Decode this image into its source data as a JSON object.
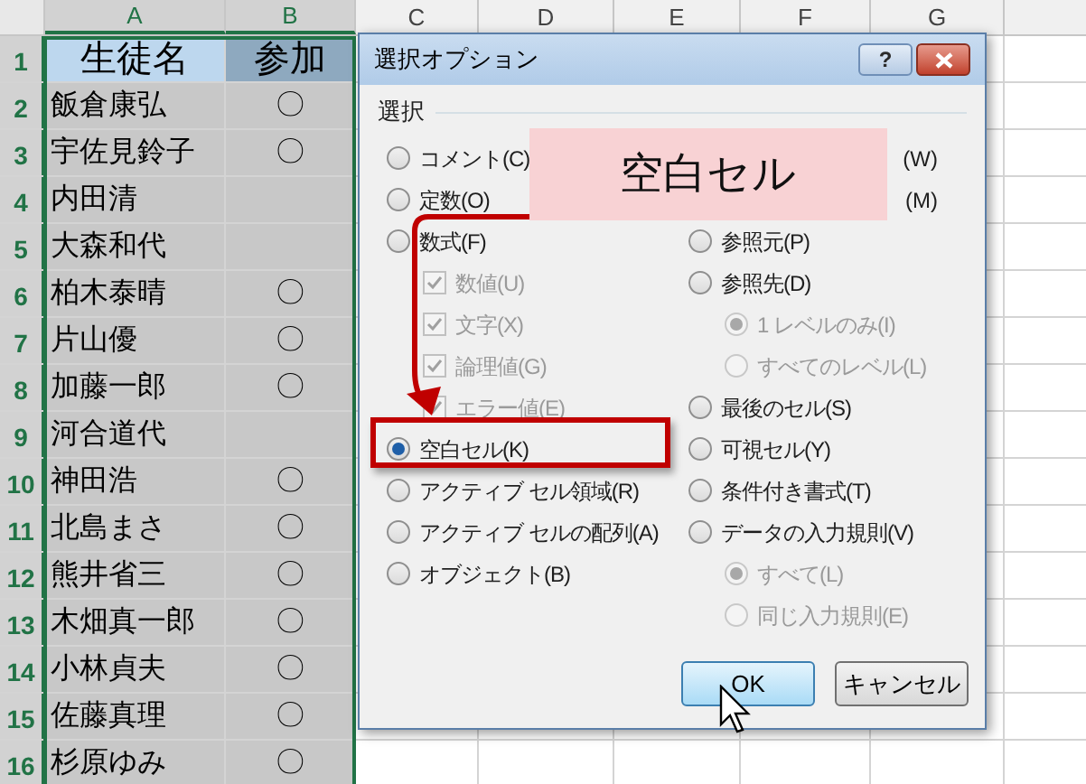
{
  "sheet": {
    "columns": [
      {
        "label": "A",
        "selected": true
      },
      {
        "label": "B",
        "selected": true
      },
      {
        "label": "C",
        "selected": false
      },
      {
        "label": "D",
        "selected": false
      },
      {
        "label": "E",
        "selected": false
      },
      {
        "label": "F",
        "selected": false
      },
      {
        "label": "G",
        "selected": false
      }
    ],
    "rows": [
      {
        "number": "1",
        "selected": true,
        "kind": "header",
        "cells": [
          "生徒名",
          "参加"
        ]
      },
      {
        "number": "2",
        "selected": true,
        "kind": "data",
        "cells": [
          "飯倉康弘",
          "〇"
        ]
      },
      {
        "number": "3",
        "selected": true,
        "kind": "data",
        "cells": [
          "宇佐見鈴子",
          "〇"
        ]
      },
      {
        "number": "4",
        "selected": true,
        "kind": "data",
        "cells": [
          "内田清"
        ]
      },
      {
        "number": "5",
        "selected": true,
        "kind": "data",
        "cells": [
          "大森和代"
        ]
      },
      {
        "number": "6",
        "selected": true,
        "kind": "data",
        "cells": [
          "柏木泰晴",
          "〇"
        ]
      },
      {
        "number": "7",
        "selected": true,
        "kind": "data",
        "cells": [
          "片山優",
          "〇"
        ]
      },
      {
        "number": "8",
        "selected": true,
        "kind": "data",
        "cells": [
          "加藤一郎",
          "〇"
        ]
      },
      {
        "number": "9",
        "selected": true,
        "kind": "data",
        "cells": [
          "河合道代"
        ]
      },
      {
        "number": "10",
        "selected": true,
        "kind": "data",
        "cells": [
          "神田浩",
          "〇"
        ]
      },
      {
        "number": "11",
        "selected": true,
        "kind": "data",
        "cells": [
          "北島まさ",
          "〇"
        ]
      },
      {
        "number": "12",
        "selected": true,
        "kind": "data",
        "cells": [
          "熊井省三",
          "〇"
        ]
      },
      {
        "number": "13",
        "selected": true,
        "kind": "data",
        "cells": [
          "木畑真一郎",
          "〇"
        ]
      },
      {
        "number": "14",
        "selected": true,
        "kind": "data",
        "cells": [
          "小林貞夫",
          "〇"
        ]
      },
      {
        "number": "15",
        "selected": true,
        "kind": "data",
        "cells": [
          "佐藤真理",
          "〇"
        ]
      },
      {
        "number": "16",
        "selected": true,
        "kind": "data",
        "cells": [
          "杉原ゆみ",
          "〇"
        ]
      }
    ]
  },
  "dialog": {
    "title": "選択オプション",
    "help": "?",
    "group_label": "選択",
    "left": [
      {
        "kind": "radio",
        "label": "コメント(C)",
        "selected": false,
        "disabled": false
      },
      {
        "kind": "radio",
        "label": "定数(O)",
        "selected": false,
        "disabled": false
      },
      {
        "kind": "radio",
        "label": "数式(F)",
        "selected": false,
        "disabled": false,
        "children": [
          {
            "kind": "checkbox",
            "label": "数値(U)",
            "checked": true,
            "disabled": true
          },
          {
            "kind": "checkbox",
            "label": "文字(X)",
            "checked": true,
            "disabled": true
          },
          {
            "kind": "checkbox",
            "label": "論理値(G)",
            "checked": true,
            "disabled": true
          },
          {
            "kind": "checkbox",
            "label": "エラー値(E)",
            "checked": true,
            "disabled": true
          }
        ]
      },
      {
        "kind": "radio",
        "label": "空白セル(K)",
        "selected": true,
        "disabled": false
      },
      {
        "kind": "radio",
        "label": "アクティブ セル領域(R)",
        "selected": false,
        "disabled": false
      },
      {
        "kind": "radio",
        "label": "アクティブ セルの配列(A)",
        "selected": false,
        "disabled": false
      },
      {
        "kind": "radio",
        "label": "オブジェクト(B)",
        "selected": false,
        "disabled": false
      }
    ],
    "right": [
      {
        "kind": "covered",
        "label": "(W)"
      },
      {
        "kind": "covered",
        "label": "(M)"
      },
      {
        "kind": "radio",
        "label": "参照元(P)",
        "selected": false,
        "disabled": false
      },
      {
        "kind": "radio",
        "label": "参照先(D)",
        "selected": false,
        "disabled": false,
        "children": [
          {
            "kind": "radio",
            "label": "1 レベルのみ(I)",
            "selected": true,
            "disabled": true
          },
          {
            "kind": "radio",
            "label": "すべてのレベル(L)",
            "selected": false,
            "disabled": true
          }
        ]
      },
      {
        "kind": "radio",
        "label": "最後のセル(S)",
        "selected": false,
        "disabled": false
      },
      {
        "kind": "radio",
        "label": "可視セル(Y)",
        "selected": false,
        "disabled": false
      },
      {
        "kind": "radio",
        "label": "条件付き書式(T)",
        "selected": false,
        "disabled": false
      },
      {
        "kind": "radio",
        "label": "データの入力規則(V)",
        "selected": false,
        "disabled": false,
        "children": [
          {
            "kind": "radio",
            "label": "すべて(L)",
            "selected": true,
            "disabled": true
          },
          {
            "kind": "radio",
            "label": "同じ入力規則(E)",
            "selected": false,
            "disabled": true
          }
        ]
      }
    ],
    "buttons": [
      {
        "label": "OK",
        "default": true
      },
      {
        "label": "キャンセル",
        "default": false
      }
    ]
  },
  "callout": {
    "text": "空白セル"
  }
}
